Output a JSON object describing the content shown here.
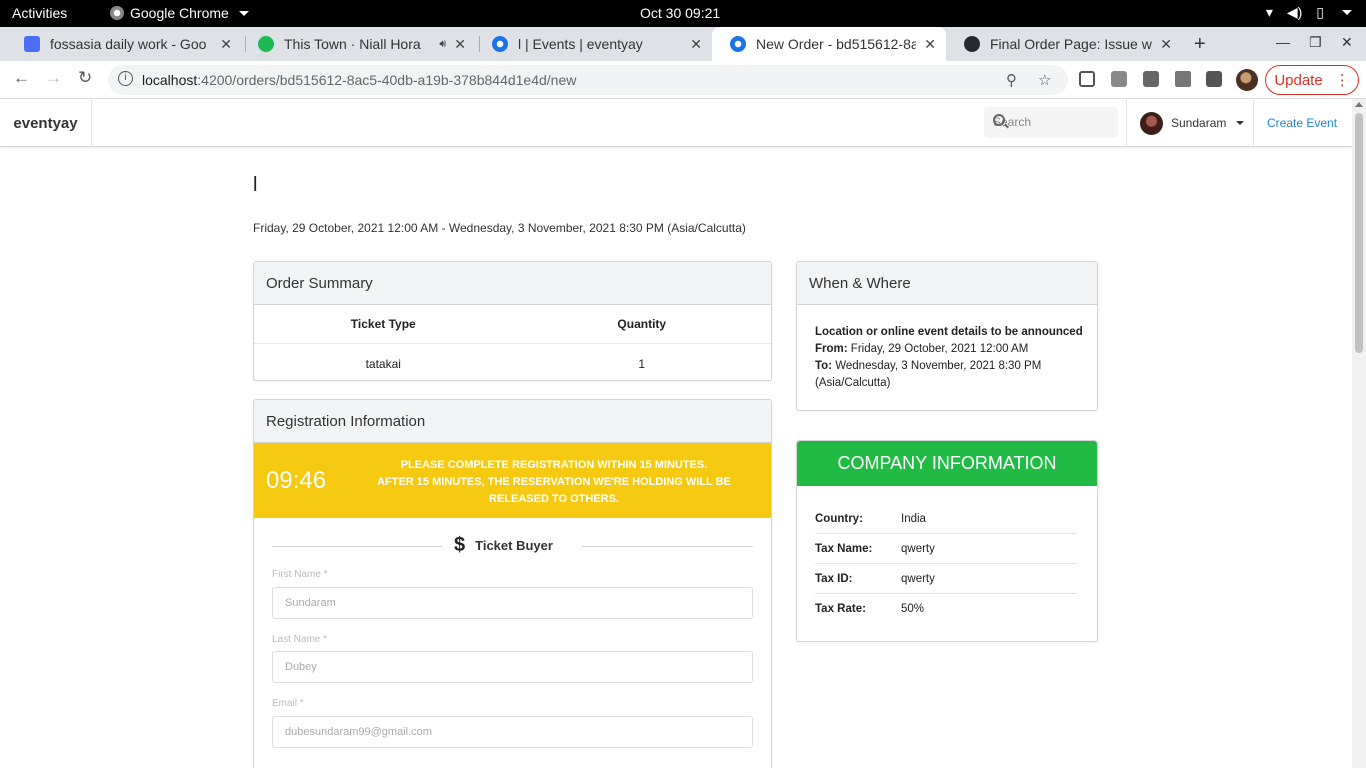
{
  "os_bar": {
    "activities": "Activities",
    "app_name": "Google Chrome",
    "clock": "Oct 30  09:21"
  },
  "tabs": [
    {
      "title": "fossasia daily work - Goo",
      "icon": "docs-icon",
      "color": "#4c6ef5"
    },
    {
      "title": "This Town · Niall Hora",
      "icon": "spotify-icon",
      "color": "#1db954"
    },
    {
      "title": "l | Events | eventyay",
      "icon": "eventyay-icon",
      "color": "#1a73e8"
    },
    {
      "title": "New Order - bd515612-8a",
      "icon": "eventyay-icon",
      "color": "#1a73e8"
    },
    {
      "title": "Final Order Page: Issue w",
      "icon": "github-icon",
      "color": "#24292e"
    }
  ],
  "address_bar": {
    "host": "localhost",
    "path": ":4200/orders/bd515612-8ac5-40db-a19b-378b844d1e4d/new",
    "update_label": "Update"
  },
  "app_nav": {
    "brand": "eventyay",
    "search_placeholder": "Search",
    "user_name": "Sundaram",
    "create_event": "Create Event"
  },
  "event": {
    "title": "l",
    "dates": "Friday, 29 October, 2021 12:00 AM - Wednesday, 3 November, 2021 8:30 PM (Asia/Calcutta)"
  },
  "order_summary": {
    "heading": "Order Summary",
    "col_ticket": "Ticket Type",
    "col_qty": "Quantity",
    "rows": [
      {
        "ticket": "tatakai",
        "qty": "1"
      }
    ]
  },
  "registration": {
    "heading": "Registration Information",
    "timer": "09:46",
    "message_line1": "PLEASE COMPLETE REGISTRATION WITHIN 15 MINUTES.",
    "message_line2": "AFTER 15 MINUTES, THE RESERVATION WE'RE HOLDING WILL BE RELEASED TO OTHERS.",
    "buyer_title": "Ticket Buyer",
    "first_name_label": "First Name *",
    "first_name_value": "Sundaram",
    "last_name_label": "Last Name *",
    "last_name_value": "Dubey",
    "email_label": "Email *",
    "email_value": "dubesundaram99@gmail.com"
  },
  "when_where": {
    "heading": "When & Where",
    "location": "Location or online event details to be announced",
    "from_label": "From:",
    "from_value": "Friday, 29 October, 2021 12:00 AM",
    "to_label": "To:",
    "to_value": "Wednesday, 3 November, 2021 8:30 PM (Asia/Calcutta)"
  },
  "company": {
    "heading": "COMPANY INFORMATION",
    "rows": [
      {
        "key": "Country:",
        "value": "India"
      },
      {
        "key": "Tax Name:",
        "value": "qwerty"
      },
      {
        "key": "Tax ID:",
        "value": "qwerty"
      },
      {
        "key": "Tax Rate:",
        "value": "50%"
      }
    ]
  },
  "colors": {
    "timer_bar": "#f5c90f",
    "company_header": "#21ba45",
    "link": "#2185d0"
  }
}
